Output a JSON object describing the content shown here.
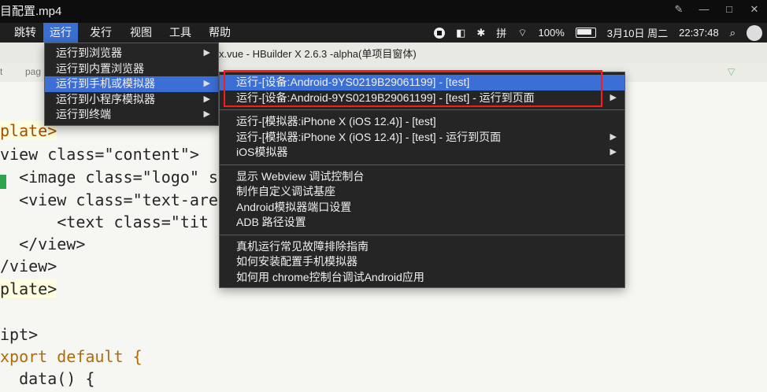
{
  "window": {
    "file_title": "目配置.mp4"
  },
  "mac_menubar": {
    "items": [
      "跳转",
      "运行",
      "发行",
      "视图",
      "工具",
      "帮助"
    ],
    "status": {
      "battery": "100%",
      "date": "3月10日 周二",
      "time": "22:37:48"
    }
  },
  "editor": {
    "title": "x.vue - HBuilder X 2.6.3 -alpha(单项目窗体)",
    "breadcrumb": [
      "t",
      "pag"
    ],
    "code_lines": [
      "plate>",
      "view class=\"content\">",
      "  <image class=\"logo\" s",
      "  <view class=\"text-are",
      "      <text class=\"tit",
      "  </view>",
      "/view>",
      "plate>",
      "",
      "ipt>",
      "xport default {",
      "  data() {"
    ]
  },
  "menus": {
    "run_menu": [
      "运行到浏览器",
      "运行到内置浏览器",
      "运行到手机或模拟器",
      "运行到小程序模拟器",
      "运行到终端"
    ],
    "device_menu": {
      "group1": [
        "运行-[设备:Android-9YS0219B29061199] - [test]",
        "运行-[设备:Android-9YS0219B29061199] - [test] - 运行到页面"
      ],
      "group2": [
        "运行-[模拟器:iPhone X (iOS 12.4)] - [test]",
        "运行-[模拟器:iPhone X (iOS 12.4)] - [test] - 运行到页面",
        "iOS模拟器"
      ],
      "group3": [
        "显示 Webview 调试控制台",
        "制作自定义调试基座",
        "Android模拟器端口设置",
        "ADB 路径设置"
      ],
      "group4": [
        "真机运行常见故障排除指南",
        "如何安装配置手机模拟器",
        "如何用 chrome控制台调试Android应用"
      ]
    }
  },
  "colors": {
    "accent": "#3c6fd6",
    "highlight_box": "#ff1a1a"
  }
}
